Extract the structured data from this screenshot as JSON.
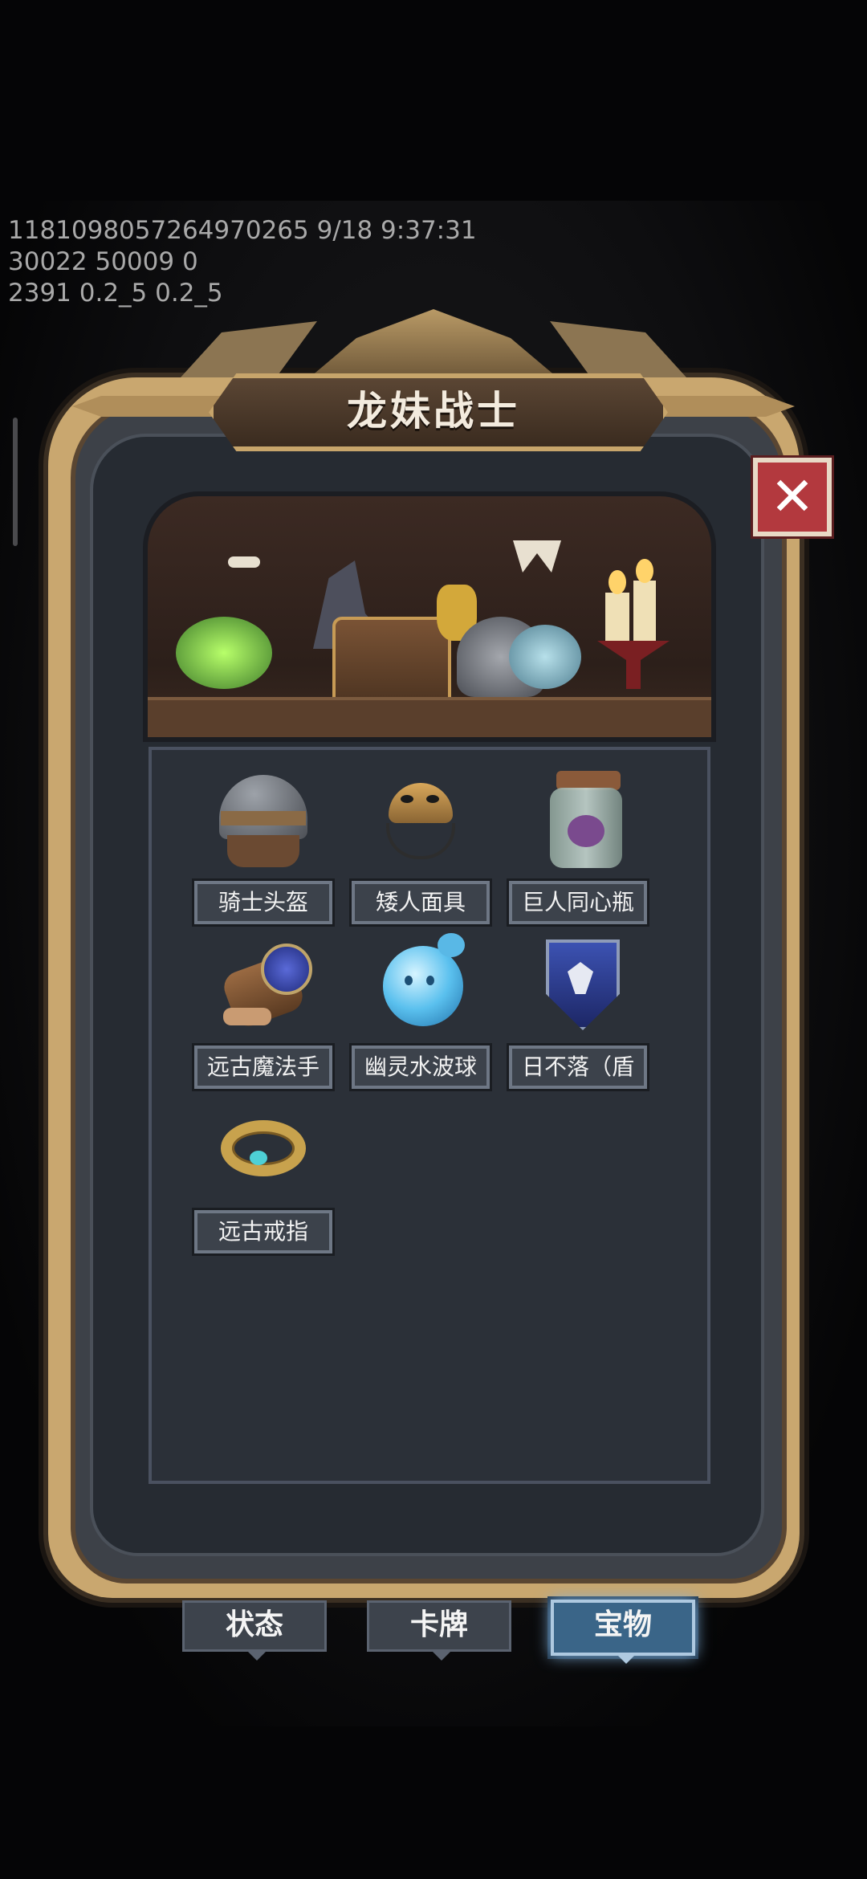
{
  "debug": {
    "line1": "1181098057264970265 9/18 9:37:31",
    "line2": "30022 50009 0",
    "line3": "2391 0.2_5 0.2_5"
  },
  "panel": {
    "title": "龙妹战士",
    "close_label": "✕"
  },
  "items": [
    {
      "label": "骑士头盔",
      "icon": "knight-helmet-icon",
      "color": "#6b6f75"
    },
    {
      "label": "矮人面具",
      "icon": "dwarf-mask-icon",
      "color": "#b3874a"
    },
    {
      "label": "巨人同心瓶",
      "icon": "giant-jar-icon",
      "color": "#9fb1a2"
    },
    {
      "label": "远古魔法手",
      "icon": "ancient-magic-gauntlet-icon",
      "color": "#7b5233"
    },
    {
      "label": "幽灵水波球",
      "icon": "ghost-water-orb-icon",
      "color": "#59b8e6"
    },
    {
      "label": "日不落（盾",
      "icon": "never-setting-sun-shield-icon",
      "color": "#2f3f8e"
    },
    {
      "label": "远古戒指",
      "icon": "ancient-ring-icon",
      "color": "#c8a24d"
    }
  ],
  "tabs": [
    {
      "label": "状态",
      "active": false
    },
    {
      "label": "卡牌",
      "active": false
    },
    {
      "label": "宝物",
      "active": true
    }
  ],
  "colors": {
    "frame_gold": "#c9a76f",
    "panel_bg": "#262b32",
    "close_red": "#b3393e",
    "tab_active": "#3a6588"
  }
}
